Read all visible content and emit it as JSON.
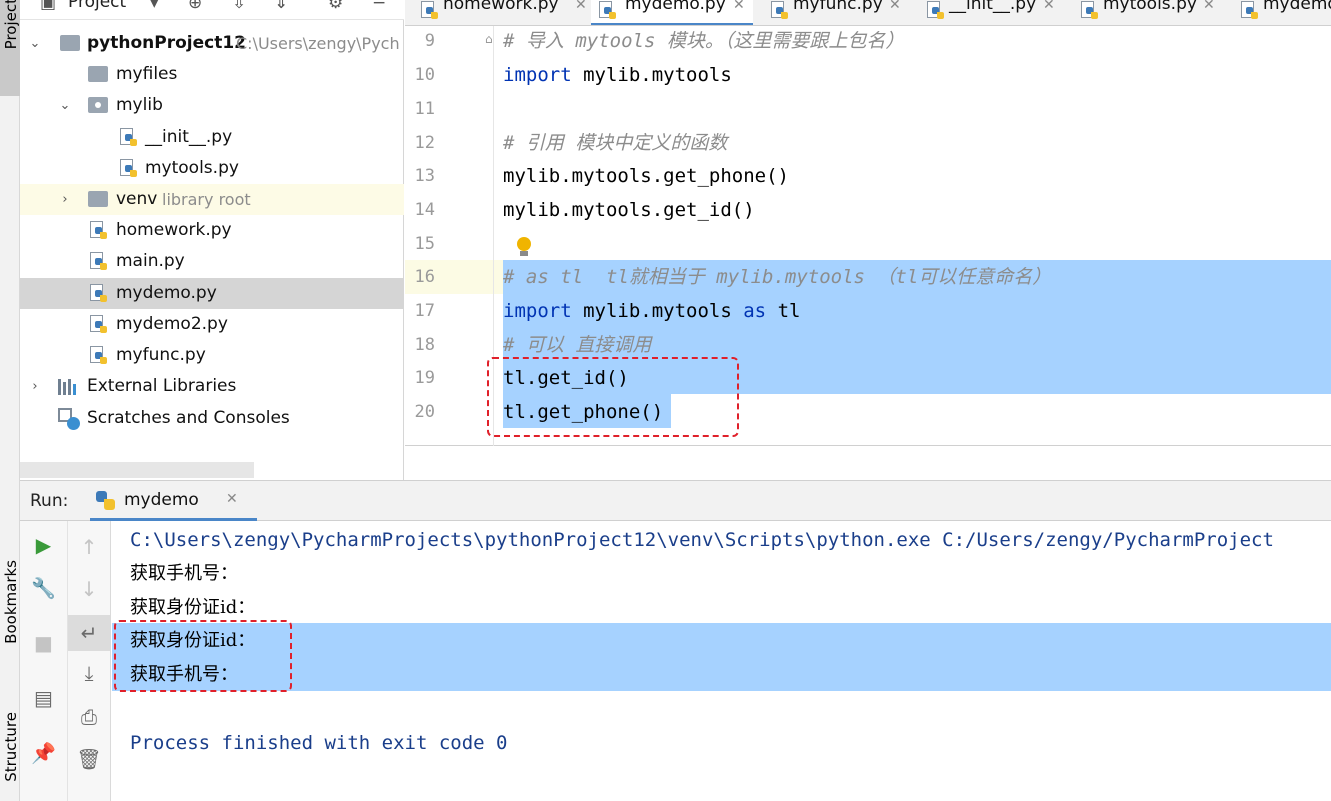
{
  "sidebar": {
    "project_stripe_label": "Project",
    "bookmarks_label": "Bookmarks",
    "structure_label": "Structure"
  },
  "project_panel": {
    "title": "Project",
    "toolbar_icons": [
      "chevron-down-icon",
      "locate-icon",
      "expand-all-icon",
      "collapse-all-icon",
      "gear-icon",
      "minimize-icon"
    ],
    "tree": [
      {
        "label": "pythonProject12",
        "hint": "C:\\Users\\zengy\\Pych",
        "type": "project-folder",
        "expanded": true
      },
      {
        "label": "myfiles",
        "type": "folder"
      },
      {
        "label": "mylib",
        "type": "package",
        "expanded": true
      },
      {
        "label": "__init__.py",
        "type": "py"
      },
      {
        "label": "mytools.py",
        "type": "py"
      },
      {
        "label": "venv",
        "hint": "library root",
        "type": "folder",
        "expanded": false
      },
      {
        "label": "homework.py",
        "type": "py"
      },
      {
        "label": "main.py",
        "type": "py"
      },
      {
        "label": "mydemo.py",
        "type": "py",
        "selected": true
      },
      {
        "label": "mydemo2.py",
        "type": "py"
      },
      {
        "label": "myfunc.py",
        "type": "py"
      },
      {
        "label": "External Libraries",
        "type": "libraries",
        "expanded": false
      },
      {
        "label": "Scratches and Consoles",
        "type": "scratches"
      }
    ]
  },
  "tabs": [
    {
      "label": "homework.py",
      "active": false
    },
    {
      "label": "mydemo.py",
      "active": true
    },
    {
      "label": "myfunc.py",
      "active": false
    },
    {
      "label": "__init__.py",
      "active": false
    },
    {
      "label": "mytools.py",
      "active": false
    },
    {
      "label": "mydemo",
      "active": false
    }
  ],
  "editor": {
    "lines": [
      {
        "n": "9",
        "text": "# 导入 mytools 模块。（这里需要跟上包名）"
      },
      {
        "n": "10",
        "kw": "import",
        "rest": " mylib.mytools"
      },
      {
        "n": "11",
        "text": ""
      },
      {
        "n": "12",
        "text": "# 引用 模块中定义的函数"
      },
      {
        "n": "13",
        "text": "mylib.mytools.get_phone()"
      },
      {
        "n": "14",
        "text": "mylib.mytools.get_id()"
      },
      {
        "n": "15",
        "text": ""
      },
      {
        "n": "16",
        "text": "# as tl  tl就相当于 mylib.mytools （tl可以任意命名）"
      },
      {
        "n": "17",
        "kw": "import",
        "mid": " mylib.mytools ",
        "kw2": "as",
        "rest": " tl"
      },
      {
        "n": "18",
        "text": "# 可以 直接调用"
      },
      {
        "n": "19",
        "text": "tl.get_id()"
      },
      {
        "n": "20",
        "text": "tl.get_phone()"
      }
    ]
  },
  "run": {
    "label": "Run:",
    "tab_label": "mydemo",
    "console": [
      "C:\\Users\\zengy\\PycharmProjects\\pythonProject12\\venv\\Scripts\\python.exe C:/Users/zengy/PycharmProject",
      "获取手机号：",
      "获取身份证id：",
      "获取身份证id：",
      "获取手机号：",
      "",
      "Process finished with exit code 0"
    ]
  }
}
